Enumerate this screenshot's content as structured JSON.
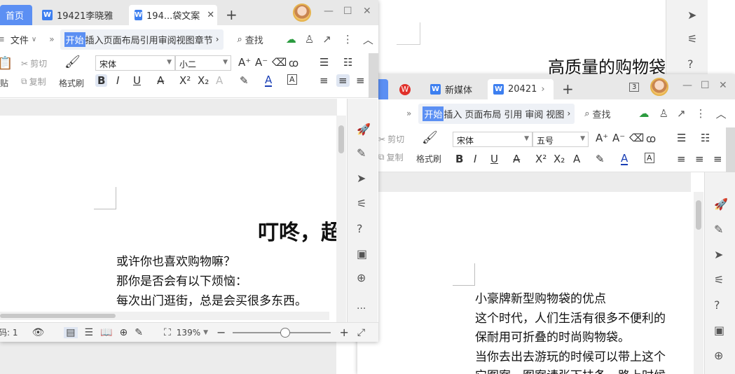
{
  "background_doc": {
    "title": "高质量的购物袋"
  },
  "left_window": {
    "tabs": [
      {
        "label": "首页"
      },
      {
        "label": "19421李晓雅"
      },
      {
        "label": "194...袋文案"
      }
    ],
    "menu": {
      "file": "文件",
      "items": [
        "开始",
        "插入",
        "页面布局",
        "引用",
        "审阅",
        "视图",
        "章节"
      ],
      "search": "查找"
    },
    "ribbon": {
      "cut": "剪切",
      "copy": "复制",
      "paste": "贴",
      "format_painter": "格式刷",
      "font": "宋体",
      "size": "小二"
    },
    "document": {
      "heading": "叮咚，超",
      "lines": [
        "或许你也喜欢购物嘛？",
        "那你是否会有以下烦恼：",
        "每次出门逛街，总是会买很多东西。"
      ]
    },
    "status": {
      "page": "码: 1",
      "zoom": "139%"
    },
    "rail_more": "..."
  },
  "right_window": {
    "tabs": [
      {
        "label": "新媒体"
      },
      {
        "label": "20421"
      }
    ],
    "badge": "3",
    "menu": {
      "items": [
        "开始",
        "插入",
        "页面布局",
        "引用",
        "审阅",
        "视图"
      ],
      "search": "查找"
    },
    "ribbon": {
      "cut": "剪切",
      "copy": "复制",
      "format_painter": "格式刷",
      "font": "宋体",
      "size": "五号"
    },
    "document": {
      "lines": [
        "小豪牌新型购物袋的优点",
        "    这个时代，人们生活有很多不便利的",
        "保耐用可折叠的时尚购物袋。",
        "    当你去出去游玩的时候可以带上这个",
        "它图案、图案请张下扶条，路上时候"
      ]
    }
  },
  "colors": {
    "accent": "#5b8ff3",
    "doc_icon": "#3d7ff0",
    "wps_red": "#e0302a"
  }
}
